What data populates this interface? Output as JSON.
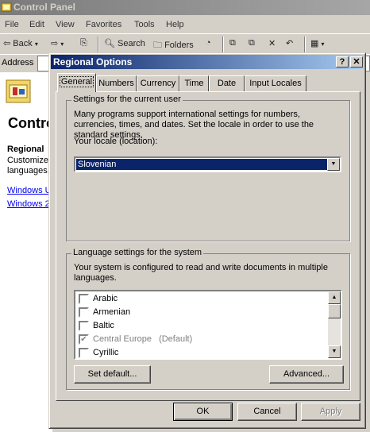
{
  "background_window": {
    "title": "Control Panel",
    "menu": [
      "File",
      "Edit",
      "View",
      "Favorites",
      "Tools",
      "Help"
    ],
    "toolbar": {
      "back": "Back",
      "search": "Search",
      "folders": "Folders"
    },
    "address_label": "Address",
    "left_pane": {
      "heading": "Contro",
      "subheading": "Regional",
      "desc_line1": "Customizes",
      "desc_line2": "languages,",
      "link1": "Windows U",
      "link2": "Windows 2"
    }
  },
  "dialog": {
    "title": "Regional Options",
    "help_button": "?",
    "close_button": "✕",
    "tabs": [
      "General",
      "Numbers",
      "Currency",
      "Time",
      "Date",
      "Input Locales"
    ],
    "active_tab": "General",
    "user_group": {
      "legend": "Settings for the current user",
      "description": "Many programs support international settings for numbers, currencies, times, and dates. Set the locale in order to use the standard settings.",
      "locale_label": "Your locale (location):",
      "locale_value": "Slovenian"
    },
    "system_group": {
      "legend": "Language settings for the system",
      "description": "Your system is configured to read and write documents in multiple languages.",
      "languages": [
        {
          "name": "Arabic",
          "checked": false,
          "note": ""
        },
        {
          "name": "Armenian",
          "checked": false,
          "note": ""
        },
        {
          "name": "Baltic",
          "checked": false,
          "note": ""
        },
        {
          "name": "Central Europe",
          "checked": true,
          "note": "(Default)"
        },
        {
          "name": "Cyrillic",
          "checked": false,
          "note": ""
        }
      ],
      "set_default_button": "Set default...",
      "advanced_button": "Advanced..."
    },
    "buttons": {
      "ok": "OK",
      "cancel": "Cancel",
      "apply": "Apply"
    }
  },
  "colors": {
    "title_active": "#0a246a",
    "title_inactive": "#7b7b7b",
    "face": "#d4d0c8",
    "link": "#0000ee"
  }
}
